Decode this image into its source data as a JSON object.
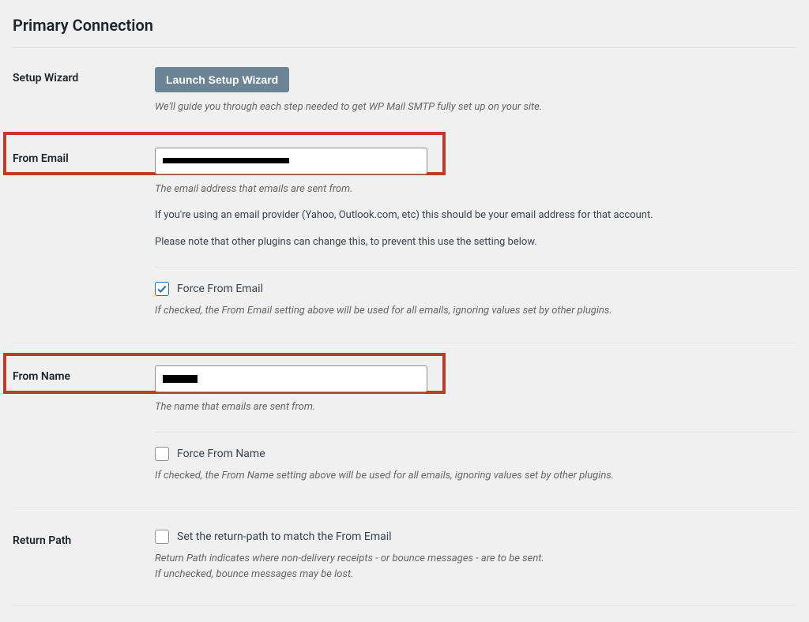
{
  "section": {
    "title": "Primary Connection"
  },
  "setup_wizard": {
    "label": "Setup Wizard",
    "button": "Launch Setup Wizard",
    "desc": "We'll guide you through each step needed to get WP Mail SMTP fully set up on your site."
  },
  "from_email": {
    "label": "From Email",
    "value": "",
    "desc1": "The email address that emails are sent from.",
    "desc2": "If you're using an email provider (Yahoo, Outlook.com, etc) this should be your email address for that account.",
    "desc3": "Please note that other plugins can change this, to prevent this use the setting below.",
    "force": {
      "checked": true,
      "label": "Force From Email",
      "desc": "If checked, the From Email setting above will be used for all emails, ignoring values set by other plugins."
    }
  },
  "from_name": {
    "label": "From Name",
    "value": "",
    "desc": "The name that emails are sent from.",
    "force": {
      "checked": false,
      "label": "Force From Name",
      "desc": "If checked, the From Name setting above will be used for all emails, ignoring values set by other plugins."
    }
  },
  "return_path": {
    "label": "Return Path",
    "checked": false,
    "chk_label": "Set the return-path to match the From Email",
    "desc1": "Return Path indicates where non-delivery receipts - or bounce messages - are to be sent.",
    "desc2": "If unchecked, bounce messages may be lost."
  }
}
